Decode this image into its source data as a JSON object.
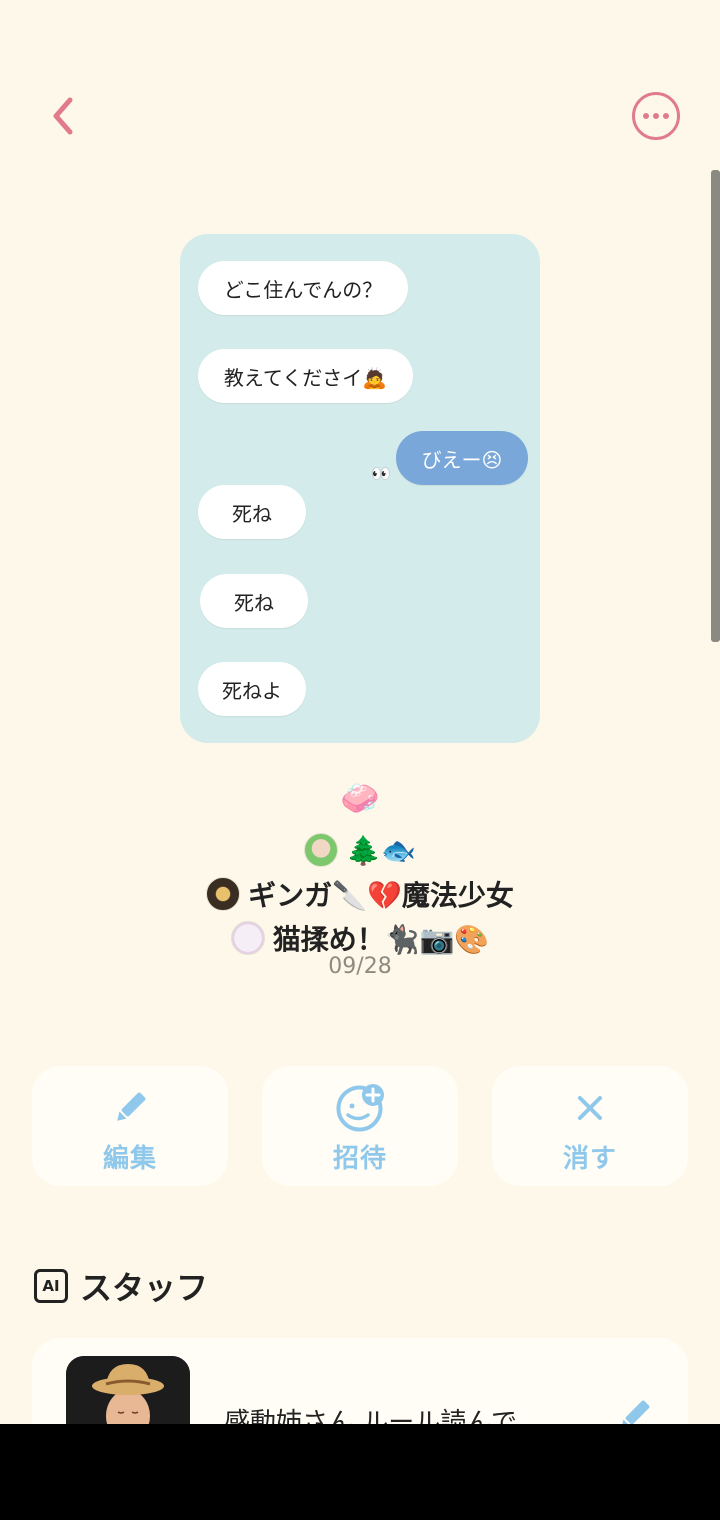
{
  "header": {
    "back_icon": "chevron-left-icon",
    "more_icon": "more-horizontal-circle-icon",
    "accent_color": "#e07b8c"
  },
  "chat_preview": {
    "messages": [
      {
        "text": "どこ住んでんの？",
        "side": "left"
      },
      {
        "text": "教えてくださイ🙇",
        "side": "left"
      },
      {
        "text": "びえー😣",
        "side": "right"
      },
      {
        "text": "死ね",
        "side": "left"
      },
      {
        "text": "死ね",
        "side": "left"
      },
      {
        "text": "死ねよ",
        "side": "left"
      }
    ],
    "peek_emoji": "👀",
    "background": "#d3ebea",
    "my_bubble_color": "#7aa7d9"
  },
  "group": {
    "emoji": "🧼",
    "members": [
      {
        "name": "🌲🐟",
        "avatar": "green-hair-avatar"
      },
      {
        "name": "ギンガ🔪💔魔法少女",
        "avatar": "dark-gold-avatar"
      },
      {
        "name": "猫揉め！🐈‍⬛📷🎨",
        "avatar": "pastel-avatar"
      }
    ],
    "date": "09/28"
  },
  "actions": [
    {
      "label": "編集",
      "icon": "pencil-icon"
    },
    {
      "label": "招待",
      "icon": "add-person-icon"
    },
    {
      "label": "消す",
      "icon": "close-icon"
    }
  ],
  "staff_section": {
    "badge": "AI",
    "title": "スタッフ",
    "card": {
      "name": "感動姉さん ルール読んで",
      "edit_icon": "pencil-icon"
    }
  }
}
